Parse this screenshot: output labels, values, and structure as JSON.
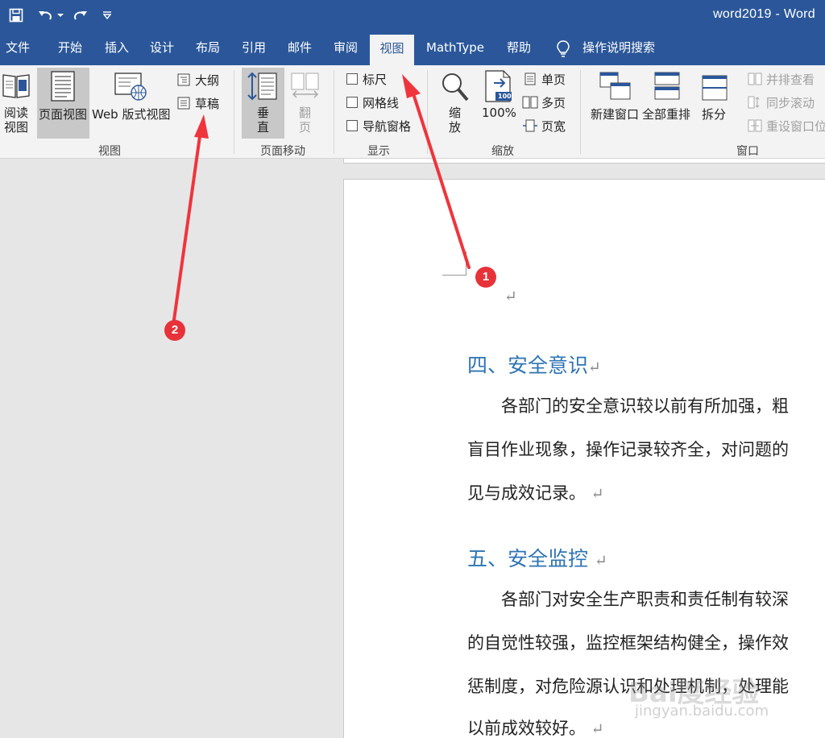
{
  "window": {
    "title": "word2019  -  Word"
  },
  "qat": {
    "save_icon": "save-icon",
    "undo_icon": "undo-icon",
    "redo_icon": "redo-icon",
    "customize_icon": "customize-qat-icon"
  },
  "tabs": [
    {
      "label": "文件"
    },
    {
      "label": "开始"
    },
    {
      "label": "插入"
    },
    {
      "label": "设计"
    },
    {
      "label": "布局"
    },
    {
      "label": "引用"
    },
    {
      "label": "邮件"
    },
    {
      "label": "审阅"
    },
    {
      "label": "视图"
    },
    {
      "label": "MathType"
    },
    {
      "label": "帮助"
    }
  ],
  "tell_me": {
    "label": "操作说明搜索"
  },
  "ribbon": {
    "views": {
      "read_line1": "阅读",
      "read_line2": "视图",
      "print_layout": "页面视图",
      "web_layout": "Web 版式视图",
      "outline": "大纲",
      "draft": "草稿",
      "label": "视图"
    },
    "page_movement": {
      "vertical_line1": "垂",
      "vertical_line2": "直",
      "side_line1": "翻",
      "side_line2": "页",
      "label": "页面移动"
    },
    "show": {
      "ruler": "标尺",
      "gridlines": "网格线",
      "nav_pane": "导航窗格",
      "label": "显示"
    },
    "zoom": {
      "zoom_line1": "缩",
      "zoom_line2": "放",
      "percent": "100%",
      "badge": "100",
      "one_page": "单页",
      "multiple_pages": "多页",
      "page_width": "页宽",
      "label": "缩放"
    },
    "window": {
      "new_window": "新建窗口",
      "arrange_all": "全部重排",
      "split": "拆分",
      "side_by_side": "并排查看",
      "sync_scroll": "同步滚动",
      "reset_position": "重设窗口位",
      "label": "窗口"
    }
  },
  "document": {
    "mark": "↵",
    "heading4": "四、安全意识",
    "para4_line1": "　　各部门的安全意识较以前有所加强，粗",
    "para4_line2": "盲目作业现象，操作记录较齐全，对问题的",
    "para4_line3": "见与成效记录。",
    "heading5": "五、安全监控",
    "para5_line1": "　　各部门对安全生产职责和责任制有较深",
    "para5_line2": "的自觉性较强，监控框架结构健全，操作效",
    "para5_line3": "惩制度，对危险源认识和处理机制，处理能",
    "para5_line4": "以前成效较好。"
  },
  "annotations": {
    "badge1": "1",
    "badge2": "2"
  },
  "watermark": {
    "brand": "Bai度经验",
    "url": "jingyan.baidu.com"
  },
  "colors": {
    "accent": "#2b579a",
    "heading": "#2e74b5",
    "badge": "#e8323a"
  }
}
